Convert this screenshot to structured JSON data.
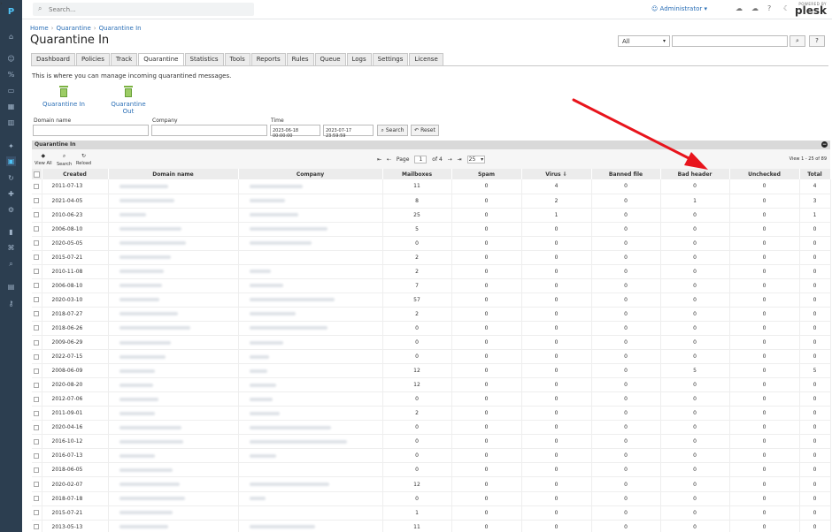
{
  "header": {
    "search_placeholder": "Search...",
    "user": "Administrator",
    "brand_powered": "POWERED BY",
    "brand_name": "plesk"
  },
  "breadcrumb": [
    "Home",
    "Quarantine",
    "Quarantine In"
  ],
  "page_title": "Quarantine In",
  "filter_select": "All",
  "tabs": [
    "Dashboard",
    "Policies",
    "Track",
    "Quarantine",
    "Statistics",
    "Tools",
    "Reports",
    "Rules",
    "Queue",
    "Logs",
    "Settings",
    "License"
  ],
  "active_tab": "Quarantine",
  "description": "This is where you can manage incoming quarantined messages.",
  "quick_links": [
    "Quarantine In",
    "Quarantine Out"
  ],
  "filters": {
    "domain_label": "Domain name",
    "company_label": "Company",
    "time_label": "Time",
    "time_from": "2023-06-18 00:00:00",
    "time_to": "2023-07-17 23:59:59",
    "search_button": "Search",
    "reset_button": "Reset"
  },
  "grid": {
    "title": "Quarantine In",
    "tools": [
      "View All",
      "Search",
      "Reload"
    ],
    "pager": {
      "page_label": "Page",
      "page": "1",
      "of_label": "of 4",
      "per_page": "25"
    },
    "view_count": "View 1 - 25 of 89",
    "columns": [
      "Created",
      "Domain name",
      "Company",
      "Mailboxes",
      "Spam",
      "Virus",
      "Banned file",
      "Bad header",
      "Unchecked",
      "Total"
    ],
    "rows": [
      [
        "2011-07-13",
        "11",
        "0",
        "4",
        "0",
        "0",
        "0",
        "4"
      ],
      [
        "2021-04-05",
        "8",
        "0",
        "2",
        "0",
        "1",
        "0",
        "3"
      ],
      [
        "2010-06-23",
        "25",
        "0",
        "1",
        "0",
        "0",
        "0",
        "1"
      ],
      [
        "2006-08-10",
        "5",
        "0",
        "0",
        "0",
        "0",
        "0",
        "0"
      ],
      [
        "2020-05-05",
        "0",
        "0",
        "0",
        "0",
        "0",
        "0",
        "0"
      ],
      [
        "2015-07-21",
        "2",
        "0",
        "0",
        "0",
        "0",
        "0",
        "0"
      ],
      [
        "2010-11-08",
        "2",
        "0",
        "0",
        "0",
        "0",
        "0",
        "0"
      ],
      [
        "2006-08-10",
        "7",
        "0",
        "0",
        "0",
        "0",
        "0",
        "0"
      ],
      [
        "2020-03-10",
        "57",
        "0",
        "0",
        "0",
        "0",
        "0",
        "0"
      ],
      [
        "2018-07-27",
        "2",
        "0",
        "0",
        "0",
        "0",
        "0",
        "0"
      ],
      [
        "2018-06-26",
        "0",
        "0",
        "0",
        "0",
        "0",
        "0",
        "0"
      ],
      [
        "2009-06-29",
        "0",
        "0",
        "0",
        "0",
        "0",
        "0",
        "0"
      ],
      [
        "2022-07-15",
        "0",
        "0",
        "0",
        "0",
        "0",
        "0",
        "0"
      ],
      [
        "2008-06-09",
        "12",
        "0",
        "0",
        "0",
        "5",
        "0",
        "5"
      ],
      [
        "2020-08-20",
        "12",
        "0",
        "0",
        "0",
        "0",
        "0",
        "0"
      ],
      [
        "2012-07-06",
        "0",
        "0",
        "0",
        "0",
        "0",
        "0",
        "0"
      ],
      [
        "2011-09-01",
        "2",
        "0",
        "0",
        "0",
        "0",
        "0",
        "0"
      ],
      [
        "2020-04-16",
        "0",
        "0",
        "0",
        "0",
        "0",
        "0",
        "0"
      ],
      [
        "2016-10-12",
        "0",
        "0",
        "0",
        "0",
        "0",
        "0",
        "0"
      ],
      [
        "2016-07-13",
        "0",
        "0",
        "0",
        "0",
        "0",
        "0",
        "0"
      ],
      [
        "2018-06-05",
        "0",
        "0",
        "0",
        "0",
        "0",
        "0",
        "0"
      ],
      [
        "2020-02-07",
        "12",
        "0",
        "0",
        "0",
        "0",
        "0",
        "0"
      ],
      [
        "2018-07-18",
        "0",
        "0",
        "0",
        "0",
        "0",
        "0",
        "0"
      ],
      [
        "2015-07-21",
        "1",
        "0",
        "0",
        "0",
        "0",
        "0",
        "0"
      ],
      [
        "2013-05-13",
        "11",
        "0",
        "0",
        "0",
        "0",
        "0",
        "0"
      ]
    ]
  },
  "colors": {
    "rail": "#2c3e50",
    "link": "#2b6fb6",
    "annotation": "#e8141c"
  }
}
